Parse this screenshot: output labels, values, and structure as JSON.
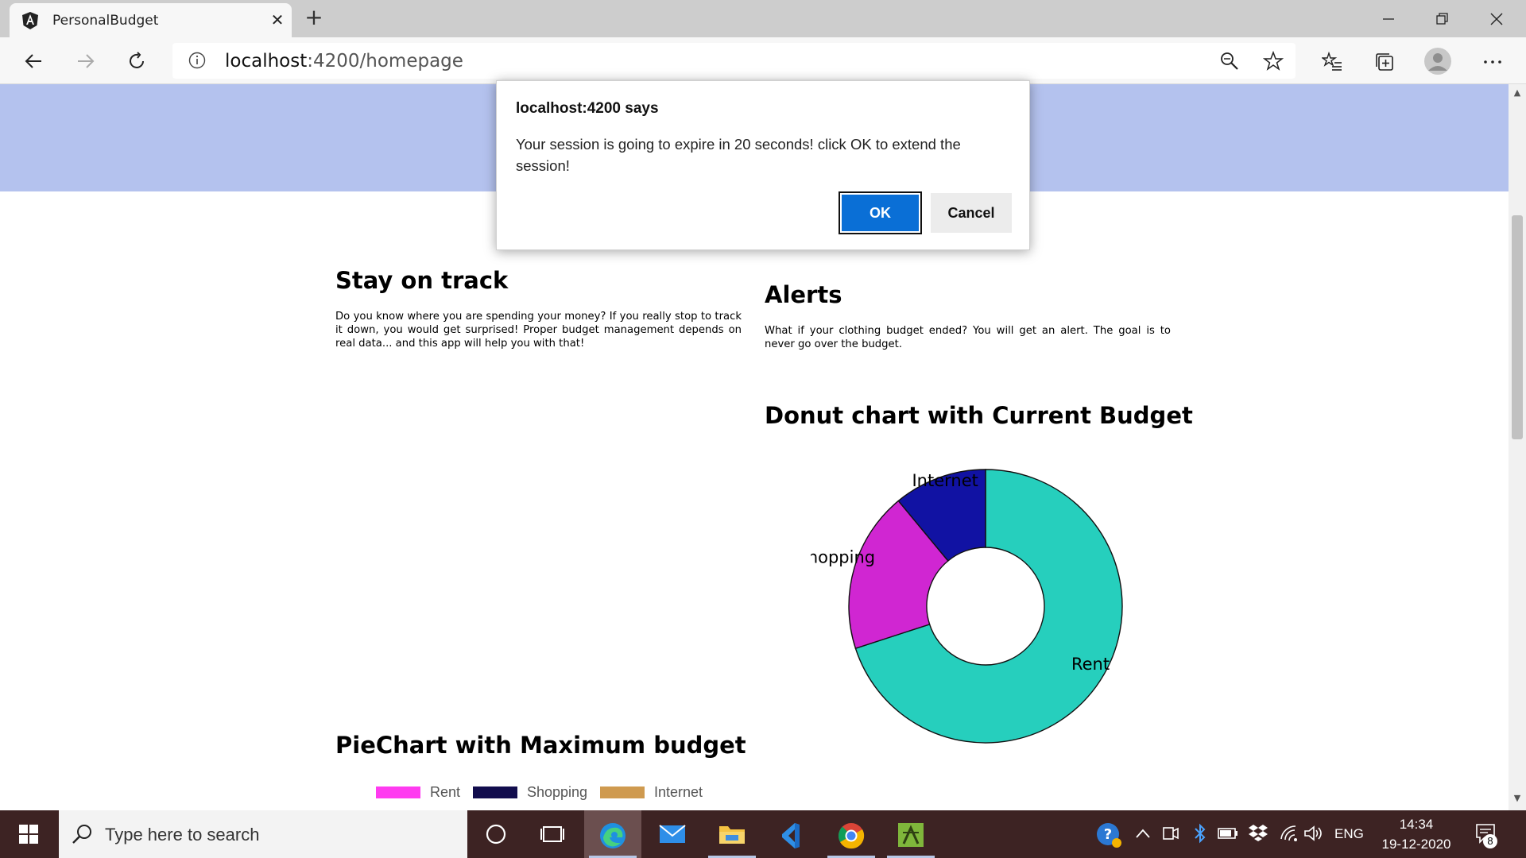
{
  "browser": {
    "tab_title": "PersonalBudget",
    "url_host": "localhost",
    "url_rest": ":4200/homepage"
  },
  "page": {
    "stay_on_track": {
      "heading": "Stay on track",
      "text": "Do you know where you are spending your money? If you really stop to track it down, you would get surprised! Proper budget management depends on real data... and this app will help you with that!"
    },
    "alerts": {
      "heading": "Alerts",
      "text": "What if your clothing budget ended? You will get an alert. The goal is to never go over the budget."
    },
    "donut_heading": "Donut chart with Current Budget",
    "pie_heading": "PieChart with Maximum budget"
  },
  "chart_data": [
    {
      "type": "pie",
      "subtype": "donut",
      "title": "Donut chart with Current Budget",
      "categories": [
        "Rent",
        "Shopping",
        "Internet"
      ],
      "values": [
        70,
        19,
        11
      ],
      "colors": [
        "#26cfbd",
        "#d026d2",
        "#1112a3"
      ]
    },
    {
      "type": "pie",
      "title": "PieChart with Maximum budget",
      "legend": [
        "Rent",
        "Shopping",
        "Internet"
      ],
      "colors": [
        "#ff3bf0",
        "#120d4d",
        "#cf9a4f"
      ]
    }
  ],
  "dialog": {
    "title": "localhost:4200 says",
    "message": "Your session is going to expire in 20 seconds! click OK to extend the session!",
    "ok_label": "OK",
    "cancel_label": "Cancel"
  },
  "taskbar": {
    "search_placeholder": "Type here to search",
    "language": "ENG",
    "time": "14:34",
    "date": "19-12-2020",
    "notification_count": "8"
  },
  "icons": {
    "browser": [
      "angular-logo-icon",
      "close-icon",
      "plus-icon",
      "minimize-icon",
      "restore-icon",
      "window-close-icon",
      "back-arrow-icon",
      "forward-arrow-icon",
      "refresh-icon",
      "info-icon",
      "zoom-icon",
      "star-icon",
      "favorites-icon",
      "collections-icon",
      "profile-icon",
      "more-icon"
    ],
    "taskbar": [
      "windows-start-icon",
      "search-icon",
      "cortana-icon",
      "task-view-icon",
      "edge-icon",
      "mail-icon",
      "file-explorer-icon",
      "visual-studio-icon",
      "chrome-icon",
      "app-icon",
      "help-icon",
      "chevron-up-icon",
      "meet-icon",
      "bluetooth-icon",
      "battery-icon",
      "dropbox-icon",
      "wifi-icon",
      "volume-icon",
      "notification-icon"
    ]
  }
}
